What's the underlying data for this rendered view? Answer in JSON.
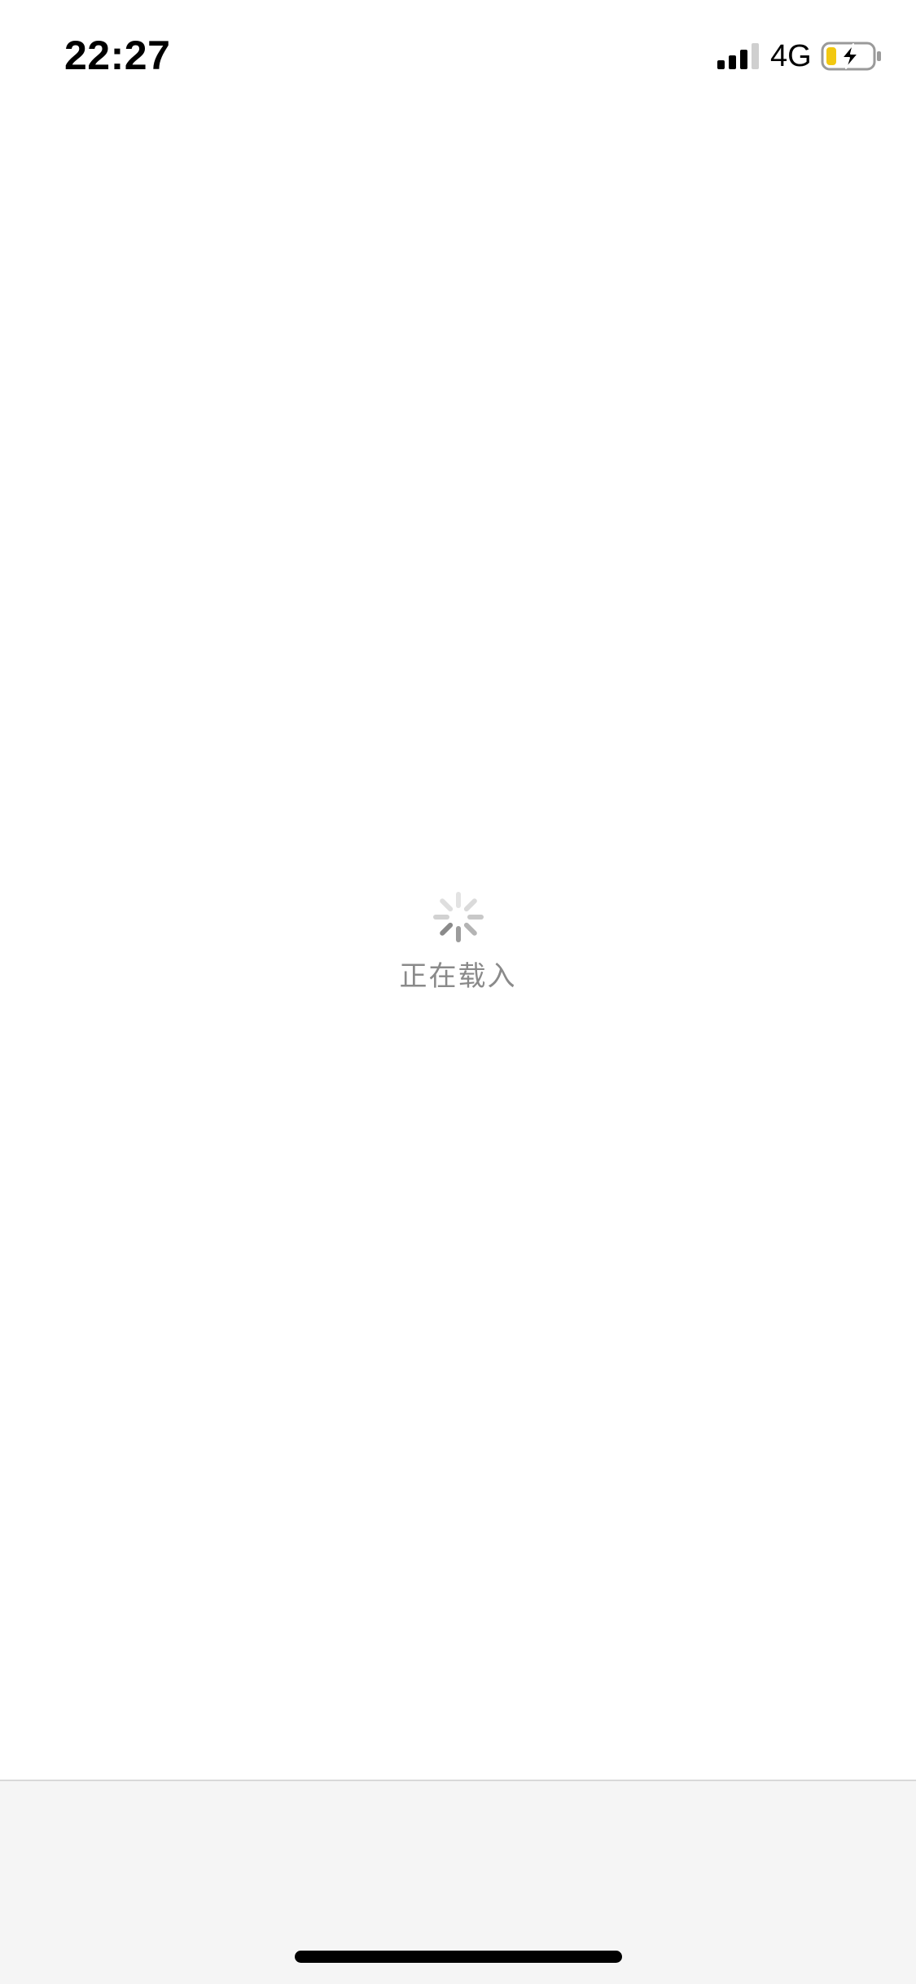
{
  "status_bar": {
    "time": "22:27",
    "network": "4G",
    "signal_bars_filled": 3,
    "signal_bars_total": 4,
    "battery_charging": true,
    "battery_color": "#f2c811"
  },
  "loading": {
    "text": "正在载入",
    "spinner_color": "#8a8a8a"
  },
  "icons": {
    "signal": "cellular-signal-icon",
    "battery": "battery-charging-icon",
    "spinner": "loading-spinner-icon"
  }
}
